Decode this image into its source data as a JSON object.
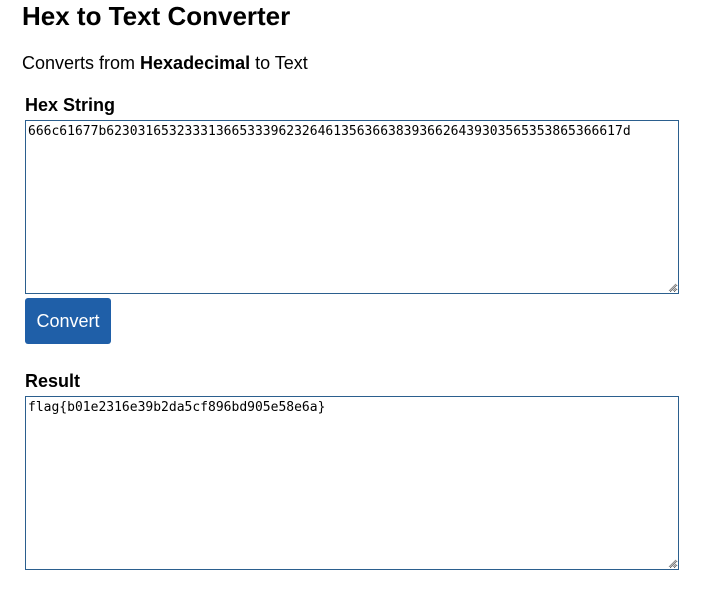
{
  "page": {
    "title": "Hex to Text Converter",
    "subtitle_prefix": "Converts from ",
    "subtitle_bold": "Hexadecimal",
    "subtitle_suffix": " to Text"
  },
  "hex_section": {
    "label": "Hex String",
    "value": "666c61677b623031653233313665333962326461356366383936626439303565353865366617d"
  },
  "convert_button": {
    "label": "Convert"
  },
  "result_section": {
    "label": "Result",
    "value": "flag{b01e2316e39b2da5cf896bd905e58e6a}"
  },
  "icons": {
    "resize_grip": "resize-grip-icon"
  },
  "colors": {
    "button_bg": "#1f5fa8",
    "textarea_border": "#2b5f8e"
  }
}
